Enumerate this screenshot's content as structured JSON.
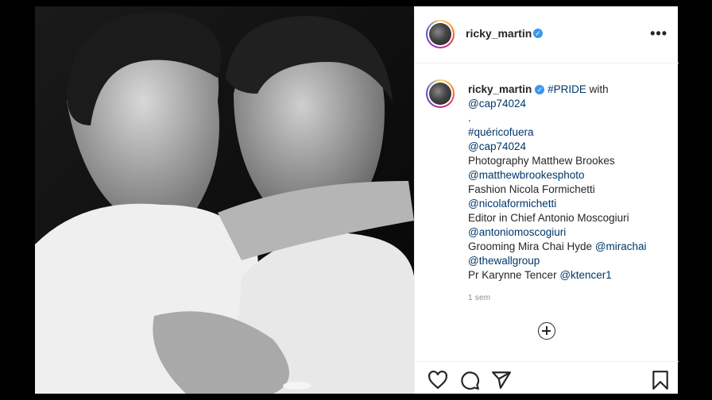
{
  "post": {
    "username": "ricky_martin",
    "verified_icon": "verified-badge-icon",
    "more_icon": "more-options-icon",
    "more_label": "•••",
    "caption": [
      [
        {
          "t": "ricky_martin",
          "c": "user"
        },
        {
          "t": " ",
          "c": "text"
        },
        {
          "t": "#PRIDE",
          "c": "link"
        },
        {
          "t": " with",
          "c": "text"
        }
      ],
      [
        {
          "t": "@cap74024",
          "c": "link"
        }
      ],
      [
        {
          "t": ".",
          "c": "text"
        }
      ],
      [
        {
          "t": "#quéricofuera",
          "c": "link"
        }
      ],
      [
        {
          "t": "@cap74024",
          "c": "link"
        }
      ],
      [
        {
          "t": "Photography Matthew Brookes",
          "c": "text"
        }
      ],
      [
        {
          "t": "@matthewbrookesphoto",
          "c": "link"
        }
      ],
      [
        {
          "t": "Fashion Nicola Formichetti",
          "c": "text"
        }
      ],
      [
        {
          "t": "@nicolaformichetti",
          "c": "link"
        }
      ],
      [
        {
          "t": "Editor in Chief Antonio Moscogiuri",
          "c": "text"
        }
      ],
      [
        {
          "t": "@antoniomoscogiuri",
          "c": "link"
        }
      ],
      [
        {
          "t": "Grooming Mira Chai Hyde ",
          "c": "text"
        },
        {
          "t": "@mirachai",
          "c": "link"
        }
      ],
      [
        {
          "t": "@thewallgroup",
          "c": "link"
        }
      ],
      [
        {
          "t": "Pr Karynne Tencer ",
          "c": "text"
        },
        {
          "t": "@ktencer1",
          "c": "link"
        }
      ]
    ],
    "timestamp": "1 sem",
    "actions": [
      "heart-icon",
      "comment-icon",
      "share-icon",
      "bookmark-icon"
    ]
  },
  "colors": {
    "link": "#00376b",
    "text": "#262626",
    "verified": "#3897f0",
    "muted": "#8e8e8e"
  }
}
